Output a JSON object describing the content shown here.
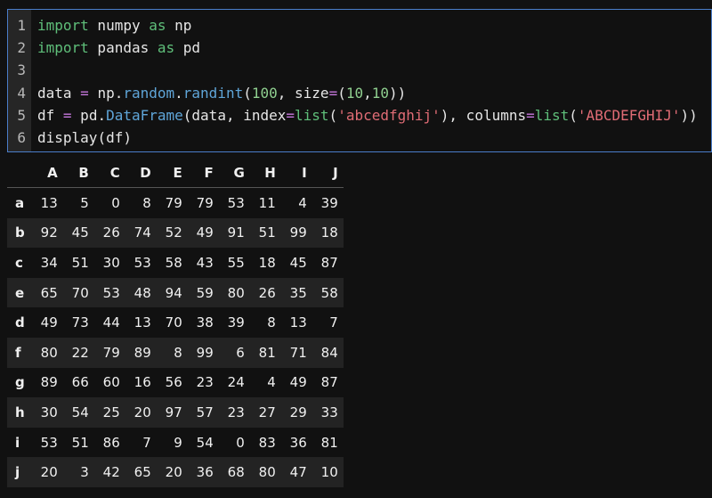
{
  "code_cell": {
    "line_numbers": [
      "1",
      "2",
      "3",
      "4",
      "5",
      "6"
    ],
    "lines": [
      [
        {
          "t": "import",
          "c": "kw"
        },
        {
          "t": " numpy ",
          "c": ""
        },
        {
          "t": "as",
          "c": "kw"
        },
        {
          "t": " np",
          "c": ""
        }
      ],
      [
        {
          "t": "import",
          "c": "kw"
        },
        {
          "t": " pandas ",
          "c": ""
        },
        {
          "t": "as",
          "c": "kw"
        },
        {
          "t": " pd",
          "c": ""
        }
      ],
      [],
      [
        {
          "t": "data ",
          "c": ""
        },
        {
          "t": "=",
          "c": "op"
        },
        {
          "t": " np.",
          "c": ""
        },
        {
          "t": "random",
          "c": "fn"
        },
        {
          "t": ".",
          "c": ""
        },
        {
          "t": "randint",
          "c": "fn"
        },
        {
          "t": "(",
          "c": ""
        },
        {
          "t": "100",
          "c": "num"
        },
        {
          "t": ", size",
          "c": ""
        },
        {
          "t": "=",
          "c": "op"
        },
        {
          "t": "(",
          "c": ""
        },
        {
          "t": "10",
          "c": "num"
        },
        {
          "t": ",",
          "c": ""
        },
        {
          "t": "10",
          "c": "num"
        },
        {
          "t": "))",
          "c": ""
        }
      ],
      [
        {
          "t": "df ",
          "c": ""
        },
        {
          "t": "=",
          "c": "op"
        },
        {
          "t": " pd.",
          "c": ""
        },
        {
          "t": "DataFrame",
          "c": "fn"
        },
        {
          "t": "(data, index",
          "c": ""
        },
        {
          "t": "=",
          "c": "op"
        },
        {
          "t": "list",
          "c": "kw"
        },
        {
          "t": "(",
          "c": ""
        },
        {
          "t": "'abcedfghij'",
          "c": "str"
        },
        {
          "t": "), columns",
          "c": ""
        },
        {
          "t": "=",
          "c": "op"
        },
        {
          "t": "list",
          "c": "kw"
        },
        {
          "t": "(",
          "c": ""
        },
        {
          "t": "'ABCDEFGHIJ'",
          "c": "str"
        },
        {
          "t": "))",
          "c": ""
        }
      ],
      [
        {
          "t": "display",
          "c": ""
        },
        {
          "t": "(df)",
          "c": ""
        }
      ]
    ]
  },
  "dataframe": {
    "corner": "",
    "columns": [
      "A",
      "B",
      "C",
      "D",
      "E",
      "F",
      "G",
      "H",
      "I",
      "J"
    ],
    "rows": [
      {
        "index": "a",
        "values": [
          "13",
          "5",
          "0",
          "8",
          "79",
          "79",
          "53",
          "11",
          "4",
          "39"
        ]
      },
      {
        "index": "b",
        "values": [
          "92",
          "45",
          "26",
          "74",
          "52",
          "49",
          "91",
          "51",
          "99",
          "18"
        ]
      },
      {
        "index": "c",
        "values": [
          "34",
          "51",
          "30",
          "53",
          "58",
          "43",
          "55",
          "18",
          "45",
          "87"
        ]
      },
      {
        "index": "e",
        "values": [
          "65",
          "70",
          "53",
          "48",
          "94",
          "59",
          "80",
          "26",
          "35",
          "58"
        ]
      },
      {
        "index": "d",
        "values": [
          "49",
          "73",
          "44",
          "13",
          "70",
          "38",
          "39",
          "8",
          "13",
          "7"
        ]
      },
      {
        "index": "f",
        "values": [
          "80",
          "22",
          "79",
          "89",
          "8",
          "99",
          "6",
          "81",
          "71",
          "84"
        ]
      },
      {
        "index": "g",
        "values": [
          "89",
          "66",
          "60",
          "16",
          "56",
          "23",
          "24",
          "4",
          "49",
          "87"
        ]
      },
      {
        "index": "h",
        "values": [
          "30",
          "54",
          "25",
          "20",
          "97",
          "57",
          "23",
          "27",
          "29",
          "33"
        ]
      },
      {
        "index": "i",
        "values": [
          "53",
          "51",
          "86",
          "7",
          "9",
          "54",
          "0",
          "83",
          "36",
          "81"
        ]
      },
      {
        "index": "j",
        "values": [
          "20",
          "3",
          "42",
          "65",
          "20",
          "36",
          "68",
          "80",
          "47",
          "10"
        ]
      }
    ]
  },
  "colors": {
    "cell_border": "#4a7dc9",
    "keyword": "#5fbf7a",
    "operator": "#c678dd",
    "function": "#5fa5d8",
    "number": "#8fcf8f",
    "string": "#e06c75"
  }
}
